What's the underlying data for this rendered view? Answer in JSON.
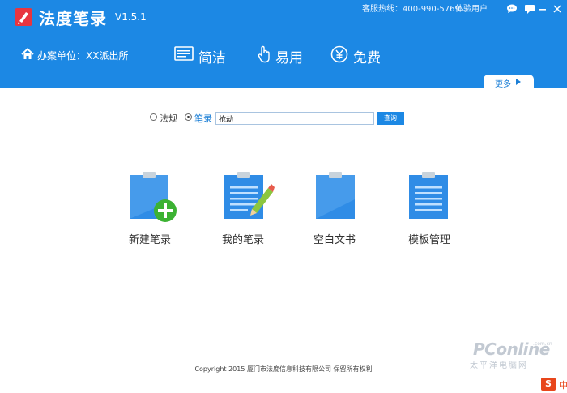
{
  "header": {
    "title": "法度笔录",
    "version": "V1.5.1",
    "hotline": "客服热线：400-990-5769",
    "user_type": "体验用户",
    "unit_label": "办案单位：",
    "unit_value": "XX派出所",
    "features": [
      {
        "label": "简洁",
        "icon": "keyboard-icon"
      },
      {
        "label": "易用",
        "icon": "hand-pointer-icon"
      },
      {
        "label": "免费",
        "icon": "yen-icon"
      }
    ],
    "more": "更多"
  },
  "search": {
    "options": [
      {
        "label": "法规",
        "checked": false
      },
      {
        "label": "笔录",
        "checked": true
      }
    ],
    "value": "抢劫",
    "button": "查询"
  },
  "actions": [
    {
      "label": "新建笔录",
      "icon": "new-record-icon"
    },
    {
      "label": "我的笔录",
      "icon": "my-records-icon"
    },
    {
      "label": "空白文书",
      "icon": "blank-document-icon"
    },
    {
      "label": "模板管理",
      "icon": "template-icon"
    }
  ],
  "footer": {
    "copyright": "Copyright  2015 厦门市法度信息科技有限公司 保留所有权利"
  },
  "watermark": {
    "text": "PConline",
    "subtext": "太平洋电脑网",
    "domain": ".com.cn"
  },
  "ime": {
    "badge": "S",
    "text": "中"
  },
  "colors": {
    "header_bg": "#1c88e4",
    "logo_red": "#e8353f",
    "doc_blue": "#2f8ce6",
    "plus_green": "#3cb233"
  }
}
